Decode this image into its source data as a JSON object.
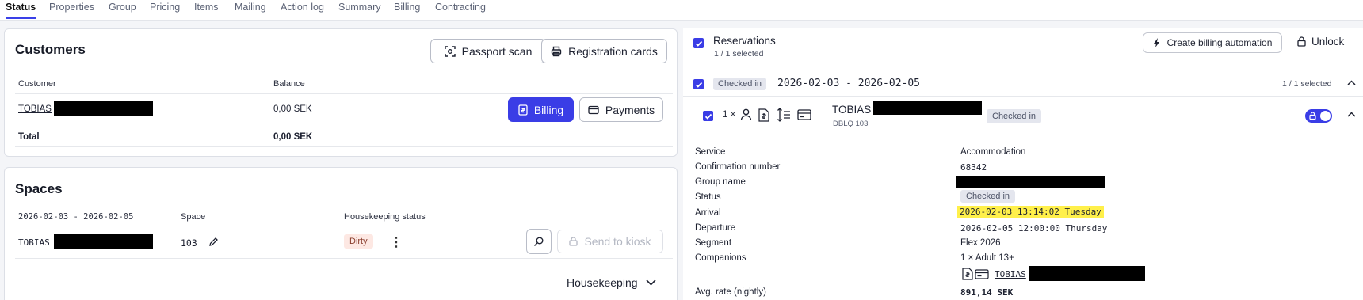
{
  "tabs": [
    "Status",
    "Properties",
    "Group",
    "Pricing",
    "Items",
    "Mailing",
    "Action log",
    "Summary",
    "Billing",
    "Contracting"
  ],
  "customers": {
    "title": "Customers",
    "passport_scan": "Passport scan",
    "registration_cards": "Registration cards",
    "col_customer": "Customer",
    "col_balance": "Balance",
    "row_name": "TOBIAS",
    "row_balance": "0,00 SEK",
    "billing": "Billing",
    "payments": "Payments",
    "total_label": "Total",
    "total_value": "0,00 SEK"
  },
  "spaces": {
    "title": "Spaces",
    "col_dates": "2026-02-03 - 2026-02-05",
    "col_space": "Space",
    "col_housekeeping": "Housekeeping status",
    "row_name": "TOBIAS",
    "row_space": "103",
    "row_status": "Dirty",
    "send_to_kiosk": "Send to kiosk",
    "housekeeping": "Housekeeping"
  },
  "reservations": {
    "title": "Reservations",
    "selected": "1 / 1 selected",
    "create_billing": "Create billing automation",
    "unlock": "Unlock",
    "group_badge": "Checked in",
    "group_dates": "2026-02-03 - 2026-02-05",
    "group_selected": "1 / 1 selected",
    "res_count": "1 ×",
    "res_name": "TOBIAS",
    "res_badge": "Checked in",
    "res_code": "DBLQ 103"
  },
  "details": {
    "service_label": "Service",
    "service_value": "Accommodation",
    "confirmation_label": "Confirmation number",
    "confirmation_value": "68342",
    "group_label": "Group name",
    "status_label": "Status",
    "status_value": "Checked in",
    "arrival_label": "Arrival",
    "arrival_value": "2026-02-03 13:14:02 Tuesday",
    "departure_label": "Departure",
    "departure_value": "2026-02-05 12:00:00 Thursday",
    "segment_label": "Segment",
    "segment_value": "Flex 2026",
    "companions_label": "Companions",
    "companions_value": "1 × Adult 13+",
    "companion_name": "TOBIAS",
    "rate_label": "Avg. rate (nightly)",
    "rate_value": "891,14 SEK"
  }
}
